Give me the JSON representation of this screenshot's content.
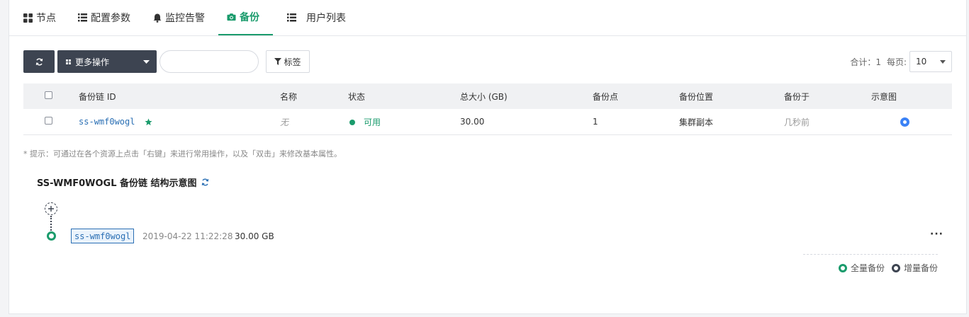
{
  "tabs": [
    {
      "label": "节点",
      "icon": "grid-icon"
    },
    {
      "label": "配置参数",
      "icon": "list-icon"
    },
    {
      "label": "监控告警",
      "icon": "bell-icon"
    },
    {
      "label": "备份",
      "icon": "camera-icon",
      "active": true
    },
    {
      "label": "用户列表",
      "icon": "list-icon"
    }
  ],
  "toolbar": {
    "more_actions_label": "更多操作",
    "search_placeholder": "",
    "tag_label": "标签",
    "total_label": "合计：1",
    "per_page_label": "每页:",
    "per_page_value": "10"
  },
  "table": {
    "headers": [
      "备份链 ID",
      "名称",
      "状态",
      "总大小 (GB)",
      "备份点",
      "备份位置",
      "备份于",
      "示意图"
    ],
    "rows": [
      {
        "id": "ss-wmf0wogl",
        "name": "无",
        "status": "可用",
        "total_size": "30.00",
        "points": "1",
        "location": "集群副本",
        "backed_up": "几秒前"
      }
    ]
  },
  "hint": "* 提示：可通过在各个资源上点击「右键」来进行常用操作，以及「双击」来修改基本属性。",
  "chain": {
    "title": "SS-WMF0WOGL 备份链 结构示意图",
    "node_label": "ss-wmf0wogl",
    "node_time": "2019-04-22 11:22:28",
    "node_size": "30.00 GB",
    "more": "···"
  },
  "legend": {
    "full": "全量备份",
    "incremental": "增量备份"
  },
  "colors": {
    "accent": "#1a9b6c",
    "dark": "#3d4451",
    "link": "#2a6fb4"
  }
}
